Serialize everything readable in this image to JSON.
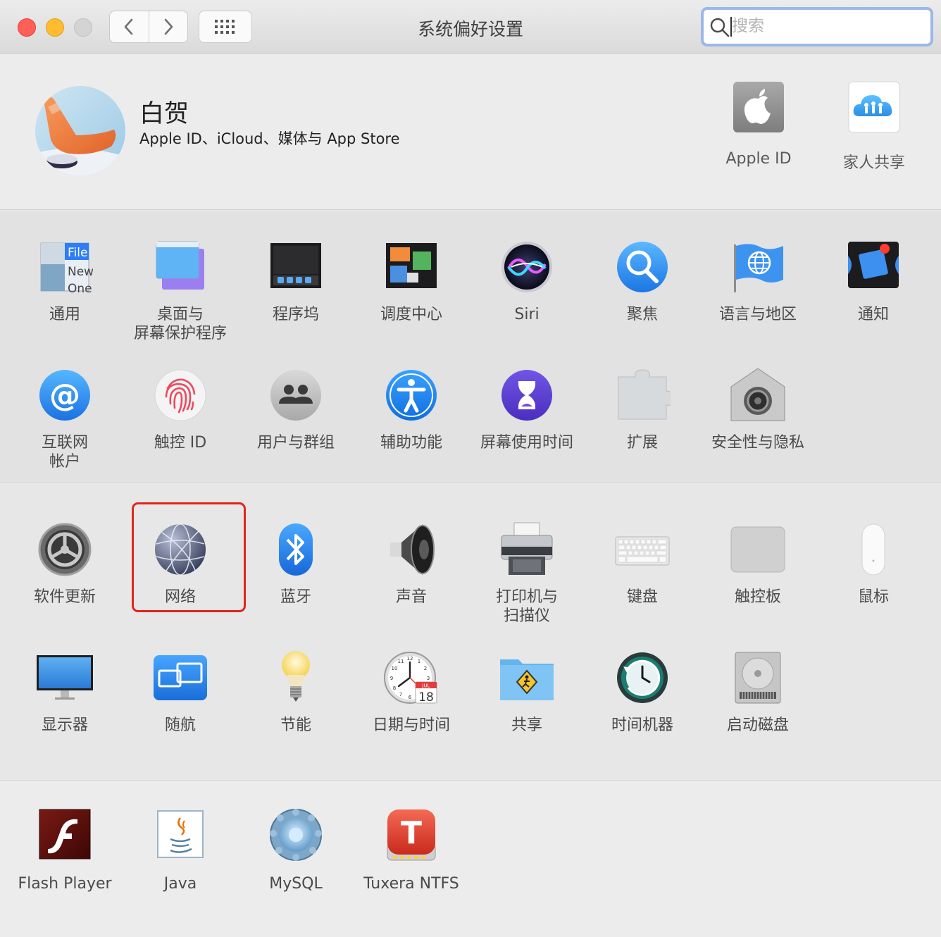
{
  "window": {
    "title": "系统偏好设置",
    "search_placeholder": "搜索"
  },
  "account": {
    "name": "白贺",
    "subtitle": "Apple ID、iCloud、媒体与 App Store",
    "items": [
      {
        "label": "Apple ID",
        "icon": "apple-logo-icon"
      },
      {
        "label": "家人共享",
        "icon": "family-sharing-icon"
      }
    ]
  },
  "section1": [
    {
      "label": "通用",
      "icon": "general-icon"
    },
    {
      "label": "桌面与\n屏幕保护程序",
      "icon": "desktop-screensaver-icon"
    },
    {
      "label": "程序坞",
      "icon": "dock-icon"
    },
    {
      "label": "调度中心",
      "icon": "mission-control-icon"
    },
    {
      "label": "Siri",
      "icon": "siri-icon"
    },
    {
      "label": "聚焦",
      "icon": "spotlight-icon"
    },
    {
      "label": "语言与地区",
      "icon": "language-region-icon"
    },
    {
      "label": "通知",
      "icon": "notifications-icon"
    },
    {
      "label": "互联网\n帐户",
      "icon": "internet-accounts-icon"
    },
    {
      "label": "触控 ID",
      "icon": "touch-id-icon"
    },
    {
      "label": "用户与群组",
      "icon": "users-groups-icon"
    },
    {
      "label": "辅助功能",
      "icon": "accessibility-icon"
    },
    {
      "label": "屏幕使用时间",
      "icon": "screen-time-icon"
    },
    {
      "label": "扩展",
      "icon": "extensions-icon"
    },
    {
      "label": "安全性与隐私",
      "icon": "security-privacy-icon"
    }
  ],
  "section2": [
    {
      "label": "软件更新",
      "icon": "software-update-icon"
    },
    {
      "label": "网络",
      "icon": "network-icon"
    },
    {
      "label": "蓝牙",
      "icon": "bluetooth-icon"
    },
    {
      "label": "声音",
      "icon": "sound-icon"
    },
    {
      "label": "打印机与\n扫描仪",
      "icon": "printers-scanners-icon"
    },
    {
      "label": "键盘",
      "icon": "keyboard-icon"
    },
    {
      "label": "触控板",
      "icon": "trackpad-icon"
    },
    {
      "label": "鼠标",
      "icon": "mouse-icon"
    },
    {
      "label": "显示器",
      "icon": "displays-icon"
    },
    {
      "label": "随航",
      "icon": "sidecar-icon"
    },
    {
      "label": "节能",
      "icon": "energy-saver-icon"
    },
    {
      "label": "日期与时间",
      "icon": "date-time-icon"
    },
    {
      "label": "共享",
      "icon": "sharing-icon"
    },
    {
      "label": "时间机器",
      "icon": "time-machine-icon"
    },
    {
      "label": "启动磁盘",
      "icon": "startup-disk-icon"
    }
  ],
  "section3": [
    {
      "label": "Flash Player",
      "icon": "flash-player-icon"
    },
    {
      "label": "Java",
      "icon": "java-icon"
    },
    {
      "label": "MySQL",
      "icon": "mysql-icon"
    },
    {
      "label": "Tuxera NTFS",
      "icon": "tuxera-ntfs-icon"
    }
  ],
  "icon_glyphs": {
    "general_file": "File",
    "general_new": "New",
    "general_one": "One",
    "date_month": "JUL",
    "date_day": "18",
    "tuxera_letter": "T",
    "java_letter": "≈"
  },
  "colors": {
    "highlight": "#e1251b",
    "accent_blue": "#2d7df6"
  }
}
